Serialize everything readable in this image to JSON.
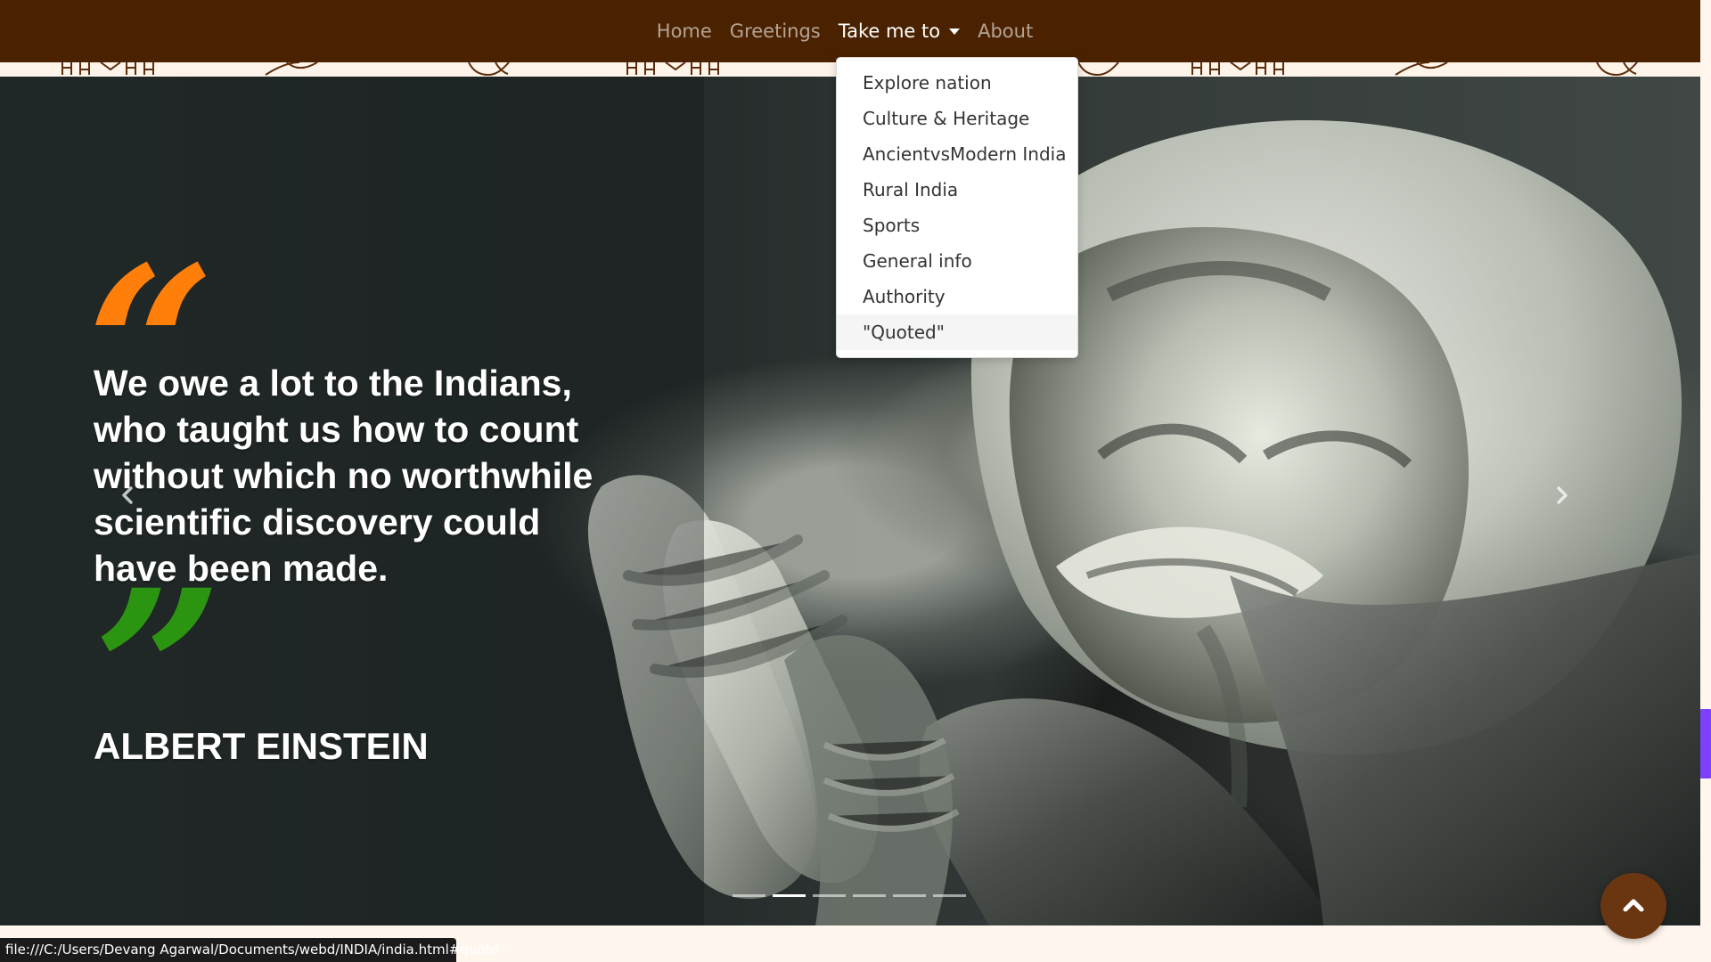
{
  "navbar": {
    "links": [
      {
        "label": "Home",
        "active": false
      },
      {
        "label": "Greetings",
        "active": false
      },
      {
        "label": "Take me to",
        "active": true,
        "has_caret": true
      },
      {
        "label": "About",
        "active": false
      }
    ],
    "background_color": "#4a2200",
    "active_color": "#ffffff",
    "inactive_color": "#b8a99d"
  },
  "dropdown": {
    "items": [
      {
        "label": "Explore nation"
      },
      {
        "label": "Culture & Heritage"
      },
      {
        "label": "AncientvsModern India"
      },
      {
        "label": "Rural India"
      },
      {
        "label": "Sports"
      },
      {
        "label": "General info"
      },
      {
        "label": "Authority"
      },
      {
        "label": "\"Quoted\"",
        "hovered": true
      }
    ]
  },
  "slide": {
    "open_quote": "“",
    "quote": "We owe a lot to the Indians, who taught us how to count without which no worthwhile scientific discovery could have been made.",
    "close_quote": "”",
    "author": "ALBERT EINSTEIN",
    "open_quote_color": "#ff7f0a",
    "close_quote_color": "#2b9512"
  },
  "carousel": {
    "indicator_count": 6,
    "active_indicator": 1
  },
  "controls": {
    "previous_icon": "chevron-left-icon",
    "next_icon": "chevron-right-icon",
    "back_to_top_icon": "chevron-up-icon"
  },
  "status_bar": {
    "url": "file:///C:/Users/Devang Agarwal/Documents/webd/INDIA/india.html#quote"
  },
  "colors": {
    "page_background": "#fff7ee",
    "scrollbar_thumb": "#7d40ff",
    "back_to_top": "#6a3612"
  }
}
